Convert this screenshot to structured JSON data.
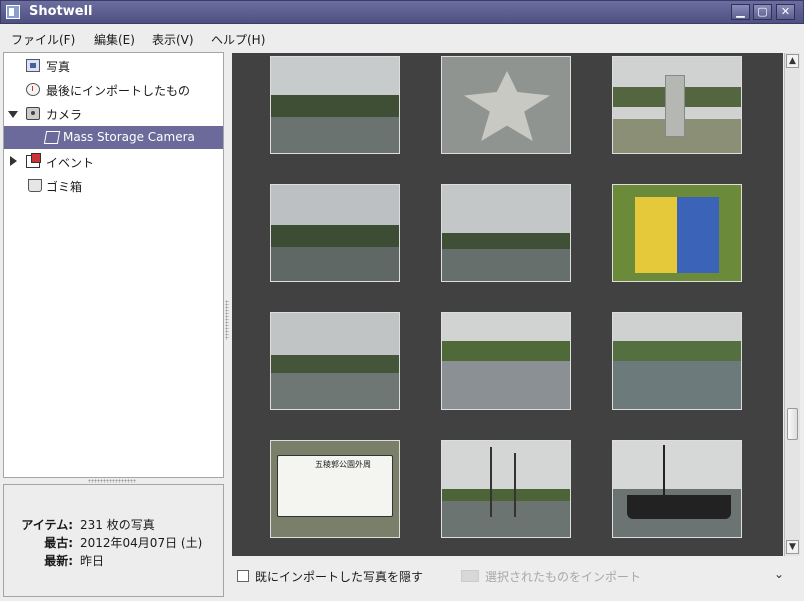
{
  "window": {
    "title": "Shotwell",
    "min_glyph": "▁",
    "max_glyph": "▢",
    "close_glyph": "✕"
  },
  "menu": [
    "ファイル(F)",
    "編集(E)",
    "表示(V)",
    "ヘルプ(H)"
  ],
  "sidebar": {
    "items": [
      {
        "label": "写真",
        "icon": "photos-icon"
      },
      {
        "label": "最後にインポートしたもの",
        "icon": "clock-icon"
      },
      {
        "label": "カメラ",
        "icon": "camera-icon",
        "expanded": true
      },
      {
        "label": "Mass Storage Camera",
        "icon": "storage-camera-icon",
        "selected": true
      },
      {
        "label": "イベント",
        "icon": "event-icon",
        "expanded": false
      },
      {
        "label": "ゴミ箱",
        "icon": "trash-icon"
      }
    ]
  },
  "info": {
    "items_key": "アイテム:",
    "items_value": "231 枚の写真",
    "oldest_key": "最古:",
    "oldest_value": "2012年04月07日 (土)",
    "newest_key": "最新:",
    "newest_value": "昨日"
  },
  "bottom": {
    "hide_imported_label": "既にインポートした写真を隠す",
    "import_selected_label": "選択されたものをインポート",
    "more_glyph": "⌄"
  },
  "scroll": {
    "up_glyph": "▲",
    "down_glyph": "▼"
  },
  "thumb_sign_text": "五稜郭公園外周"
}
